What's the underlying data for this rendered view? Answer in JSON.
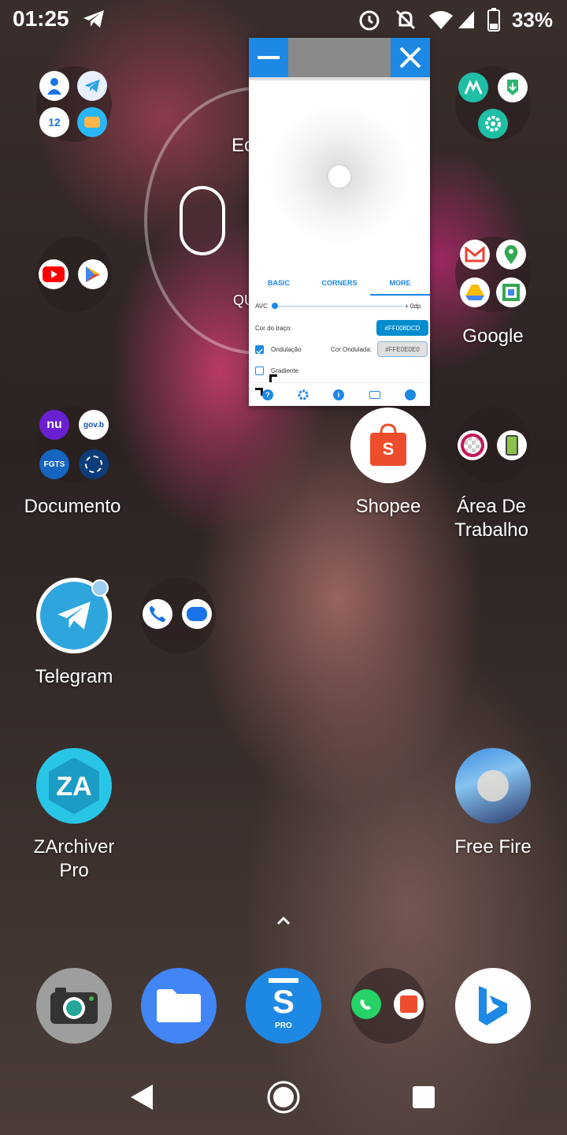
{
  "status_bar": {
    "time": "01:25",
    "battery": "33%",
    "icons": [
      "telegram-icon",
      "alarm-icon",
      "mute-icon",
      "wifi-icon",
      "signal-icon",
      "battery-icon"
    ]
  },
  "clock_widget_fragments": {
    "top": "Ec",
    "bottom": "QU"
  },
  "floating_window": {
    "tabs": [
      "BASIC",
      "CORNERS",
      "MORE"
    ],
    "active_tab": "MORE",
    "avc_label": "AVC",
    "avc_value": "+  0dp",
    "stroke_color_label": "Cor do traço:",
    "stroke_color_value": "#FF008DCD",
    "ripple_label": "Ondulação",
    "ripple_color_label": "Cor Ondulada:",
    "ripple_color_value": "#FFE0E0E0",
    "gradient_label": "Gradiente",
    "bottom_icons": [
      "help-icon",
      "gear-icon",
      "info-icon",
      "keyboard-icon",
      "palette-icon"
    ]
  },
  "apps": {
    "google": "Google",
    "documento": "Documento",
    "shopee": "Shopee",
    "area_line1": "Área De",
    "area_line2": "Trabalho",
    "telegram": "Telegram",
    "zarchiver_line1": "ZArchiver",
    "zarchiver_line2": "Pro",
    "freefire": "Free Fire"
  },
  "folder_badges": {
    "nu": "nu",
    "gov": "gov.b",
    "fgts": "FGTS",
    "calendar": "12",
    "sketchware": "PRO"
  },
  "dock": [
    "camera-icon",
    "files-icon",
    "sketchware-pro-icon",
    "whatsapp-shopee-folder",
    "bing-icon"
  ],
  "colors": {
    "accent": "#1e88e5",
    "stroke": "#008DCD",
    "ripple": "#E0E0E0"
  }
}
